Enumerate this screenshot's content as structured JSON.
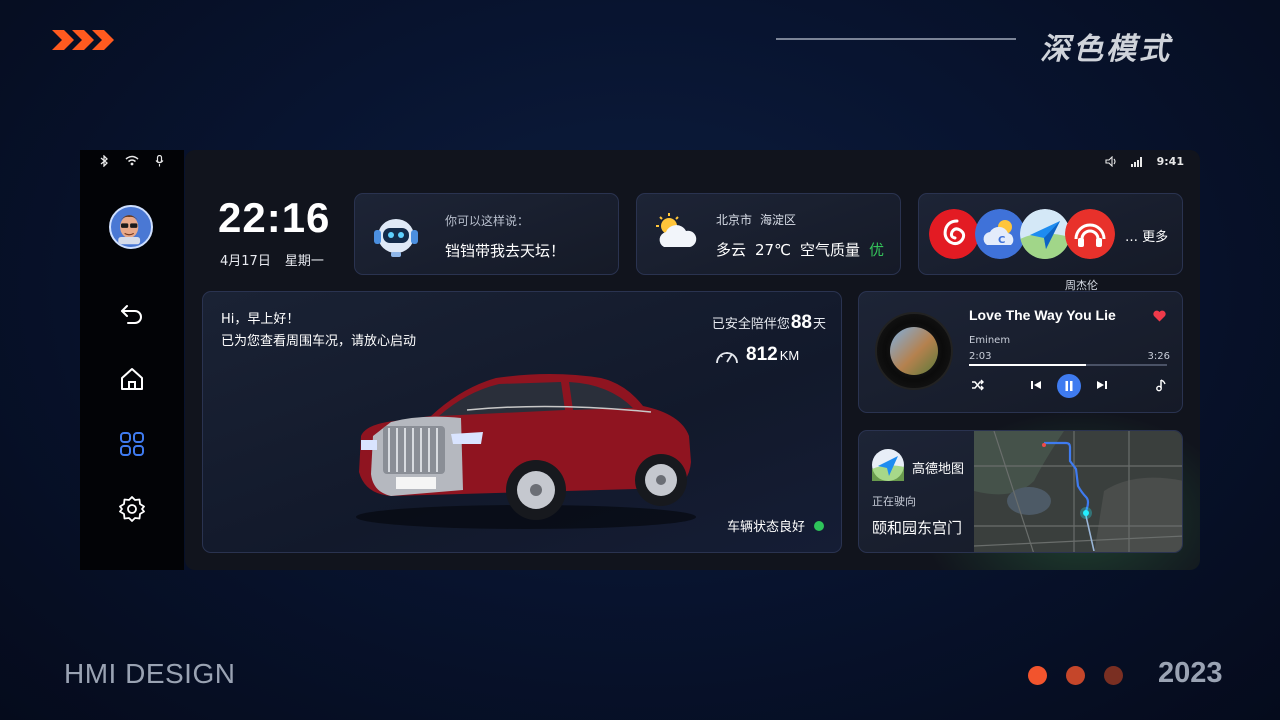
{
  "header": {
    "title": "深色模式"
  },
  "footer": {
    "left": "HMI DESIGN",
    "year": "2023",
    "dot_colors": [
      "#f2542d",
      "#c5462a",
      "#7a2f22"
    ]
  },
  "colors": {
    "accent": "#3f7bf0",
    "brand_orange": "#ff5a1f",
    "ok": "#2ec45a"
  },
  "status_bar": {
    "time": "9:41",
    "left_icons": [
      "bluetooth-icon",
      "wifi-icon",
      "microphone-icon"
    ],
    "right_icons": [
      "volume-icon",
      "signal-icon"
    ]
  },
  "rail": {
    "items": [
      "back-icon",
      "home-icon",
      "apps-grid-icon",
      "settings-icon"
    ],
    "active": "apps-grid-icon"
  },
  "clock": {
    "time": "22:16",
    "date": "4月17日",
    "weekday": "星期一"
  },
  "voice": {
    "hint": "你可以这样说：",
    "example": "铛铛带我去天坛！"
  },
  "weather": {
    "city": "北京市",
    "district": "海淀区",
    "condition": "多云",
    "temp": "27℃",
    "aq_label": "空气质量",
    "aq_value": "优"
  },
  "apps": {
    "icons": [
      "netease-music-icon",
      "weather-app-icon",
      "amap-icon",
      "radio-app-icon"
    ],
    "more": "… 更多"
  },
  "below_apps_text": "周杰伦",
  "vehicle": {
    "greeting": "Hi，早上好！",
    "check": "已为您查看周围车况，请放心启动",
    "safe_prefix": "已安全陪伴您",
    "safe_days": "88",
    "safe_suffix": "天",
    "mileage": "812",
    "mileage_unit": "KM",
    "status": "车辆状态良好"
  },
  "music": {
    "title": "Love The Way You Lie",
    "artist": "Eminem",
    "elapsed": "2:03",
    "duration": "3:26",
    "progress": 0.59,
    "liked": true,
    "controls": [
      "shuffle-icon",
      "previous-icon",
      "pause-icon",
      "next-icon",
      "lyrics-icon"
    ]
  },
  "map": {
    "app_name": "高德地图",
    "hint": "正在驶向",
    "destination": "颐和园东宫门"
  }
}
